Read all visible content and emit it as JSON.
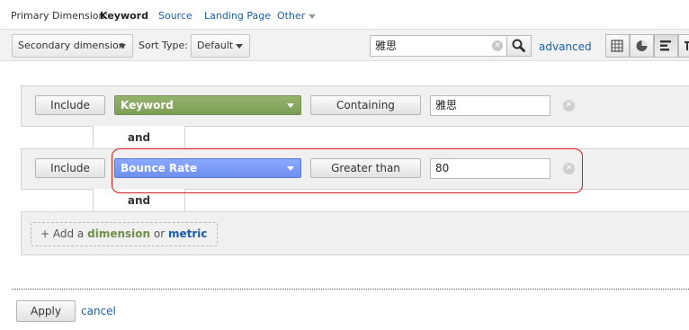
{
  "primary_dimension": {
    "label": "Primary Dimension:",
    "active": "Keyword",
    "links": [
      "Source",
      "Landing Page",
      "Other"
    ]
  },
  "toolbar": {
    "secondary_dimension": "Secondary dimension",
    "sort_type_label": "Sort Type:",
    "sort_type_value": "Default",
    "search_value": "雅思",
    "advanced_label": "advanced"
  },
  "filters": [
    {
      "mode": "Include",
      "field": "Keyword",
      "field_color": "#7c9e54",
      "operator": "Containing",
      "value": "雅思"
    },
    {
      "mode": "Include",
      "field": "Bounce Rate",
      "field_color": "#6f8ff0",
      "operator": "Greater than",
      "value": "80"
    }
  ],
  "and_label": "and",
  "add": {
    "prefix": "+ Add a",
    "dimension": "dimension",
    "or": "or",
    "metric": "metric"
  },
  "actions": {
    "apply": "Apply",
    "cancel": "cancel"
  },
  "colors": {
    "link": "#1a5ea8",
    "highlight": "#d11d1d"
  }
}
